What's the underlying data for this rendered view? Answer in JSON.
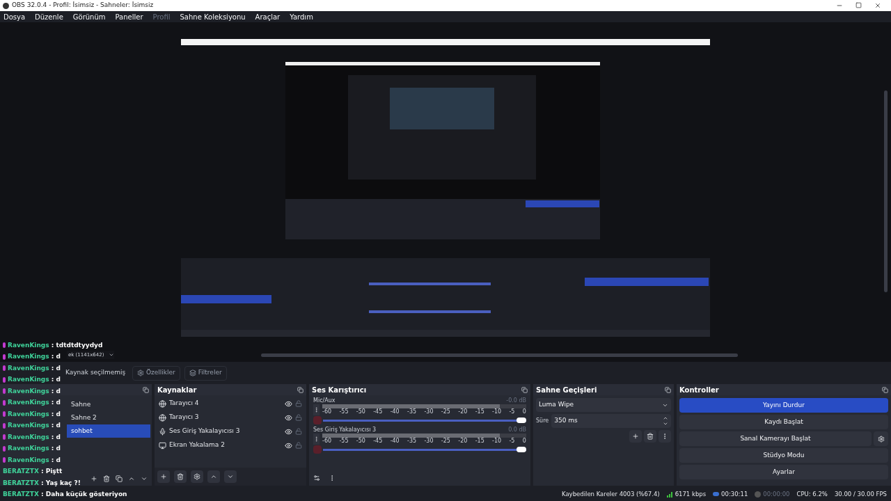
{
  "window": {
    "title": "OBS 32.0.4 - Profil: İsimsiz - Sahneler: İsimsiz"
  },
  "menu": [
    {
      "label": "Dosya",
      "disabled": false
    },
    {
      "label": "Düzenle",
      "disabled": false
    },
    {
      "label": "Görünüm",
      "disabled": false
    },
    {
      "label": "Paneller",
      "disabled": false
    },
    {
      "label": "Profil",
      "disabled": true
    },
    {
      "label": "Sahne Koleksiyonu",
      "disabled": false
    },
    {
      "label": "Araçlar",
      "disabled": false
    },
    {
      "label": "Yardım",
      "disabled": false
    }
  ],
  "preview": {
    "kind": "picture",
    "resolution": "ek (1141x642)"
  },
  "toolbar": {
    "status": "Kaynak seçilmemiş",
    "buttons": [
      {
        "label": "Özellikler",
        "kind": "properties"
      },
      {
        "label": "Filtreler",
        "kind": "filters"
      }
    ]
  },
  "scenes": {
    "items": [
      {
        "label": "Sahne",
        "selected": false
      },
      {
        "label": "Sahne 2",
        "selected": false
      },
      {
        "label": "sohbet",
        "selected": true
      }
    ]
  },
  "sources": {
    "title": "Kaynaklar",
    "items": [
      {
        "label": "Tarayıcı 4",
        "kind": "browser",
        "visible": true,
        "locked": false
      },
      {
        "label": "Tarayıcı 3",
        "kind": "browser",
        "visible": true,
        "locked": false
      },
      {
        "label": "Ses Giriş Yakalayıcısı 3",
        "kind": "mic",
        "visible": true,
        "locked": false
      },
      {
        "label": "Ekran Yakalama 2",
        "kind": "display",
        "visible": true,
        "locked": false
      }
    ]
  },
  "mixer": {
    "title": "Ses Karıştırıcı",
    "channels": [
      {
        "name": "Mic/Aux",
        "reading": "-0.0 dB",
        "level": 1,
        "muted": true,
        "scale": [
          "-60",
          "-55",
          "-50",
          "-45",
          "-40",
          "-35",
          "-30",
          "-25",
          "-20",
          "-15",
          "-10",
          "-5",
          "0"
        ]
      },
      {
        "name": "Ses Giriş Yakalayıcısı 3",
        "reading": "0.0 dB",
        "level": 1,
        "muted": true,
        "scale": [
          "-60",
          "-55",
          "-50",
          "-45",
          "-40",
          "-35",
          "-30",
          "-25",
          "-20",
          "-15",
          "-10",
          "-5",
          "0"
        ]
      }
    ]
  },
  "transitions": {
    "title": "Sahne Geçişleri",
    "transition": "Luma Wipe",
    "duration_label": "Süre",
    "duration": "350 ms"
  },
  "controls": {
    "title": "Kontroller",
    "buttons": [
      {
        "label": "Yayını Durdur",
        "active": true,
        "settings": false
      },
      {
        "label": "Kaydı Başlat",
        "active": false,
        "settings": false
      },
      {
        "label": "Sanal Kamerayı Başlat",
        "active": false,
        "settings": true
      },
      {
        "label": "Stüdyo Modu",
        "active": false,
        "settings": false
      },
      {
        "label": "Ayarlar",
        "active": false,
        "settings": false
      }
    ]
  },
  "status_bar": {
    "dropped": "Kaybedilen Kareler 4003 (%67.4)",
    "bitrate": "6171 kbps",
    "stream_time": "00:30:11",
    "record_time": "00:00:00",
    "cpu": "CPU: 6.2%",
    "fps": "30.00 / 30.00 FPS"
  },
  "chat": [
    {
      "user": "RavenKings",
      "message": ": tdtdtdtyydyd",
      "badge": true
    },
    {
      "user": "RavenKings",
      "message": ": d",
      "badge": true
    },
    {
      "user": "RavenKings",
      "message": ": d",
      "badge": true
    },
    {
      "user": "RavenKings",
      "message": ": d",
      "badge": true
    },
    {
      "user": "RavenKings",
      "message": ": d",
      "badge": true
    },
    {
      "user": "RavenKings",
      "message": ": d",
      "badge": true
    },
    {
      "user": "RavenKings",
      "message": ": d",
      "badge": true
    },
    {
      "user": "RavenKings",
      "message": ": d",
      "badge": true
    },
    {
      "user": "RavenKings",
      "message": ": d",
      "badge": true
    },
    {
      "user": "RavenKings",
      "message": ": d",
      "badge": true
    },
    {
      "user": "RavenKings",
      "message": ": d",
      "badge": true
    },
    {
      "user": "BERATZTX",
      "message": ": Piştt",
      "badge": false
    },
    {
      "user": "BERATZTX",
      "message": ": Yaş kaç ?!",
      "badge": false
    },
    {
      "user": "BERATZTX",
      "message": ": Daha küçük gösteriyon",
      "badge": false
    }
  ]
}
